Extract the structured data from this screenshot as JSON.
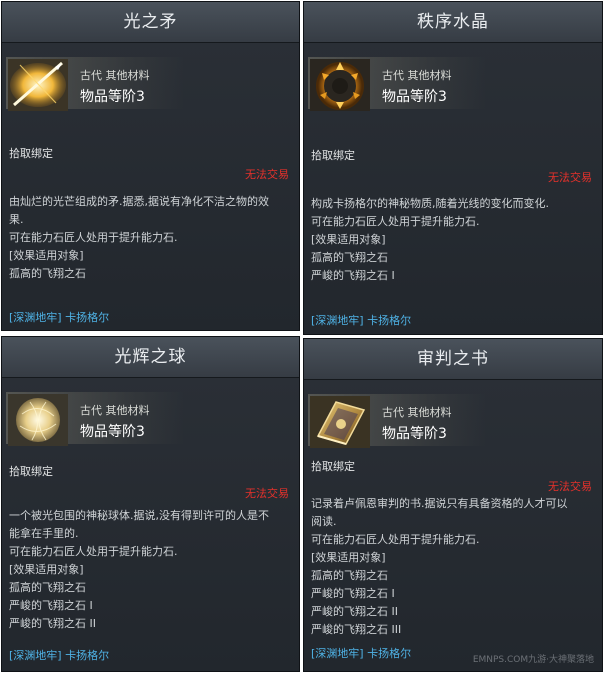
{
  "cards": [
    {
      "title": "光之矛",
      "category": "古代 其他材料",
      "tier": "物品等阶3",
      "bind": "拾取绑定",
      "trade": "无法交易",
      "desc_lines": [
        "由灿烂的光芒组成的矛.据悉,据说有净化不洁之物的效",
        "果.",
        "可在能力石匠人处用于提升能力石.",
        "[效果适用对象]",
        "孤高的飞翔之石"
      ],
      "source": "[深渊地牢] 卡扬格尔",
      "icon": "light-spear-icon"
    },
    {
      "title": "秩序水晶",
      "category": "古代 其他材料",
      "tier": "物品等阶3",
      "bind": "拾取绑定",
      "trade": "无法交易",
      "desc_lines": [
        "构成卡扬格尔的神秘物质,随着光线的变化而变化.",
        "可在能力石匠人处用于提升能力石.",
        "[效果适用对象]",
        "孤高的飞翔之石",
        "严峻的飞翔之石 I"
      ],
      "source": "[深渊地牢] 卡扬格尔",
      "icon": "order-crystal-icon"
    },
    {
      "title": "光辉之球",
      "category": "古代 其他材料",
      "tier": "物品等阶3",
      "bind": "拾取绑定",
      "trade": "无法交易",
      "desc_lines": [
        "一个被光包围的神秘球体.据说,没有得到许可的人是不",
        "能拿在手里的.",
        "可在能力石匠人处用于提升能力石.",
        "[效果适用对象]",
        "孤高的飞翔之石",
        "严峻的飞翔之石 I",
        "严峻的飞翔之石 II"
      ],
      "source": "[深渊地牢] 卡扬格尔",
      "icon": "radiant-orb-icon"
    },
    {
      "title": "审判之书",
      "category": "古代 其他材料",
      "tier": "物品等阶3",
      "bind": "拾取绑定",
      "trade": "无法交易",
      "desc_lines": [
        "记录着卢佩恩审判的书.据说只有具备资格的人才可以",
        "阅读.",
        "可在能力石匠人处用于提升能力石.",
        "[效果适用对象]",
        "孤高的飞翔之石",
        "严峻的飞翔之石 I",
        "严峻的飞翔之石 II",
        "严峻的飞翔之石 III"
      ],
      "source": "[深渊地牢] 卡扬格尔",
      "icon": "judgment-book-icon"
    }
  ],
  "watermark": "EMNPS.COM九游·大神聚落地",
  "colors": {
    "no_trade": "#e5312b",
    "source_link": "#4fb3e6",
    "panel_bg": "#262b31",
    "title_bar": "#40474f"
  }
}
